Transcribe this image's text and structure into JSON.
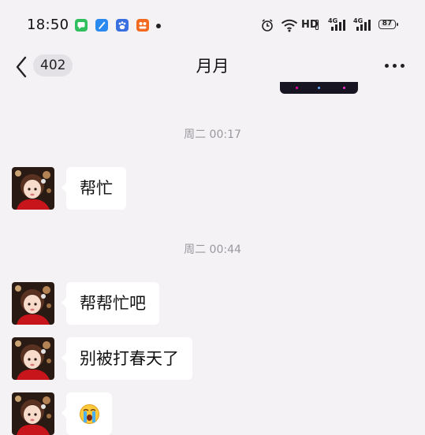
{
  "status_bar": {
    "time": "18:50",
    "network_type": "HD",
    "sim1_label": "4G",
    "sim2_label": "4G",
    "battery_level": "87",
    "app_icons": [
      {
        "name": "messages-app-icon",
        "color": "#2fbf5e"
      },
      {
        "name": "blue-app-icon",
        "color": "#2a8af0"
      },
      {
        "name": "baidu-app-icon",
        "color": "#3a6fe0"
      },
      {
        "name": "orange-app-icon",
        "color": "#f26a1f"
      }
    ]
  },
  "header": {
    "back_icon": "chevron-left-icon",
    "unread_count": "402",
    "title": "月月",
    "more_icon": "more-dots-icon"
  },
  "messages": [
    {
      "type": "timestamp",
      "text": "周二 00:17"
    },
    {
      "type": "text",
      "sender": "月月",
      "text": "帮忙"
    },
    {
      "type": "timestamp",
      "text": "周二 00:44"
    },
    {
      "type": "text",
      "sender": "月月",
      "text": "帮帮忙吧"
    },
    {
      "type": "text",
      "sender": "月月",
      "text": "别被打春天了"
    },
    {
      "type": "emoji",
      "sender": "月月",
      "emoji": "crying-face-emoji"
    }
  ],
  "colors": {
    "background": "#f5f2f6",
    "bubble": "#ffffff",
    "timestamp_text": "#9b989e"
  }
}
